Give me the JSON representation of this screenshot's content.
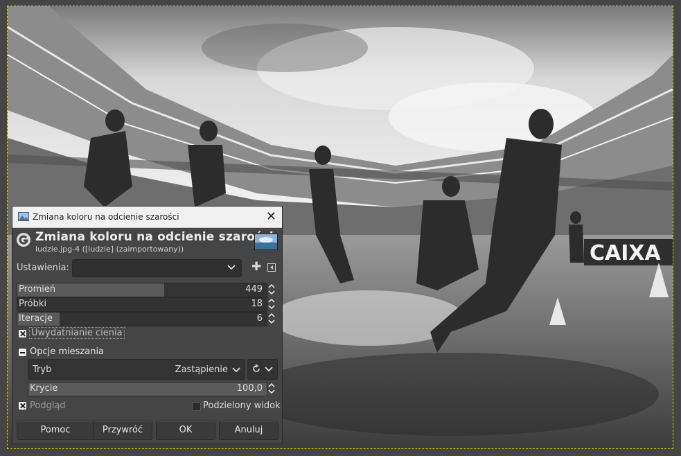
{
  "dialog": {
    "window_title": "Zmiana koloru na odcienie szarości",
    "header_title": "Zmiana koloru na odcienie szarości",
    "header_subtitle": "ludzie.jpg-4 ([ludzie] (zaimportowany))",
    "presets_label": "Ustawienia:",
    "presets_value": "",
    "sliders": [
      {
        "name": "Promień",
        "value": "449",
        "fraction": 0.59
      },
      {
        "name": "Próbki",
        "value": "18",
        "fraction": 0.0
      },
      {
        "name": "Iteracje",
        "value": "6",
        "fraction": 0.17
      }
    ],
    "shadow_checkbox": {
      "label": "Uwydatnianie cienia",
      "checked": true
    },
    "blending": {
      "label": "Opcje mieszania",
      "mode_label": "Tryb",
      "mode_value": "Zastąpienie",
      "opacity_label": "Krycie",
      "opacity_value": "100,0",
      "opacity_fraction": 1.0
    },
    "preview": {
      "label": "Podgląd",
      "checked": true
    },
    "split_view": {
      "label": "Podzielony widok",
      "checked": false
    },
    "buttons": {
      "help": "Pomoc",
      "reset": "Przywróć",
      "ok": "OK",
      "cancel": "Anuluj"
    }
  },
  "canvas": {
    "banner_text": "CAIXA"
  },
  "colors": {
    "dialog_bg": "#454545",
    "titlebar_bg": "#f0f0f0",
    "slider_fill": "#5b5b5b",
    "selection_outline": "#d8d000"
  }
}
